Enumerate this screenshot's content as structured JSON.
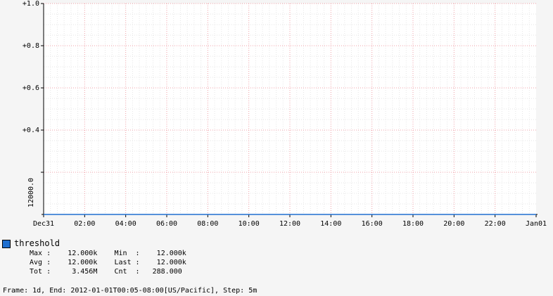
{
  "chart_data": {
    "type": "line",
    "title": "",
    "xlabel": "",
    "ylabel": "",
    "x_ticks": [
      "Dec31",
      "02:00",
      "04:00",
      "06:00",
      "08:00",
      "10:00",
      "12:00",
      "14:00",
      "16:00",
      "18:00",
      "20:00",
      "22:00",
      "Jan01"
    ],
    "y_ticks": [
      "+0.4",
      "+0.6",
      "+0.8",
      "+1.0"
    ],
    "y_extra_label": "12000.0",
    "ylim": [
      0,
      1
    ],
    "grid": true,
    "series": [
      {
        "name": "threshold",
        "color": "#1e6fd0",
        "x_start": 0,
        "x_end": 24,
        "value": 0
      }
    ]
  },
  "legend": {
    "series_name": "threshold",
    "max_label": "Max :",
    "max_value": "12.000k",
    "min_label": "Min  :",
    "min_value": "12.000k",
    "avg_label": "Avg :",
    "avg_value": "12.000k",
    "last_label": "Last :",
    "last_value": "12.000k",
    "tot_label": "Tot :",
    "tot_value": "3.456M",
    "cnt_label": "Cnt  :",
    "cnt_value": "288.000"
  },
  "footer": {
    "text": "Frame: 1d, End: 2012-01-01T00:05-08:00[US/Pacific], Step: 5m"
  }
}
